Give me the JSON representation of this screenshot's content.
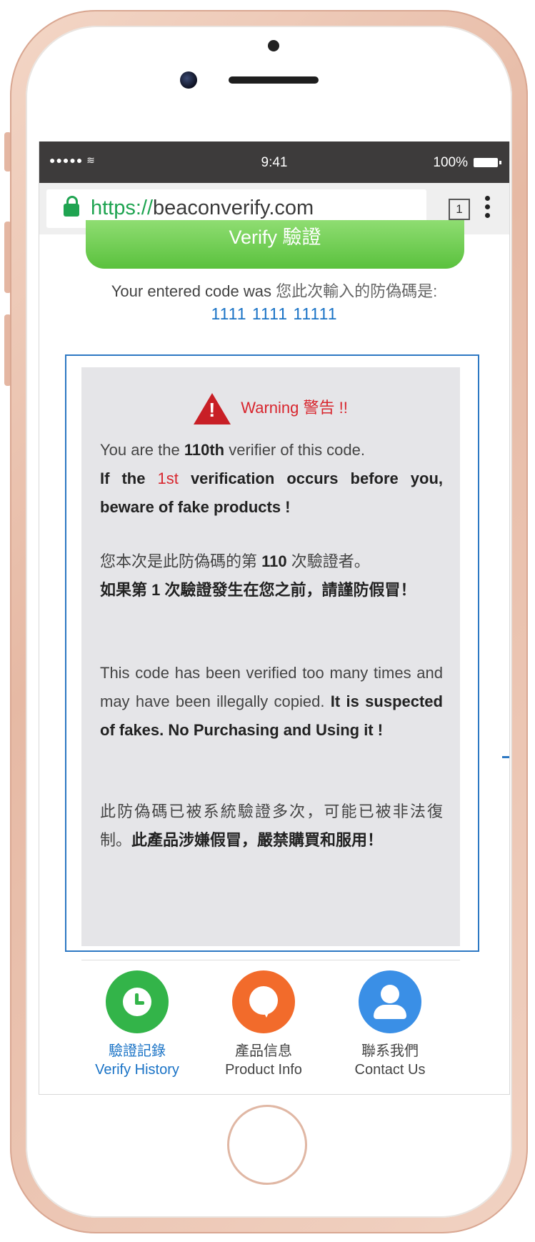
{
  "status_bar": {
    "signal": "●●●●● ≋",
    "time": "9:41",
    "battery": "100%"
  },
  "browser": {
    "url_scheme": "https://",
    "url_host": "beaconverify.com",
    "tabs_count": "1"
  },
  "verify_button_label": "Verify 驗證",
  "entered_code": {
    "label_en": "Your entered code was",
    "label_zh": "您此次輸入的防偽碼是:",
    "value": "1111 1111 11111"
  },
  "warning": {
    "title": "Warning 警告 !!",
    "p1_a": "You are the",
    "p1_count": "110th",
    "p1_b": "verifier of this code.",
    "p2_a": "If the",
    "p2_first": "1st",
    "p2_b": "verification occurs before you,",
    "p2_warn": "beware of fake products !",
    "p3_a": "您本次是此防偽碼的第",
    "p3_count": "110",
    "p3_b": "次驗證者。",
    "p4_a": "如果第",
    "p4_first": "1",
    "p4_b": "次驗證發生在您之前，",
    "p4_warn": "請謹防假冒！",
    "p5_a": "This code has been verified too many times and may have been illegally copied.",
    "p5_b": "It is suspected of fakes.",
    "p5_warn": "No Purchasing and Using it !",
    "p6_a": "此防偽碼已被系統驗證多次，可能已被非法復制。",
    "p6_b": "此產品涉嫌假冒，",
    "p6_warn": "嚴禁購買和服用！"
  },
  "nav": [
    {
      "zh": "驗證記錄",
      "en": "Verify History",
      "icon": "clock-icon",
      "color": "#33b449"
    },
    {
      "zh": "產品信息",
      "en": "Product Info",
      "icon": "chat-bubble-icon",
      "color": "#f26b2b"
    },
    {
      "zh": "聯系我們",
      "en": "Contact Us",
      "icon": "person-icon",
      "color": "#3a8fe6"
    }
  ]
}
